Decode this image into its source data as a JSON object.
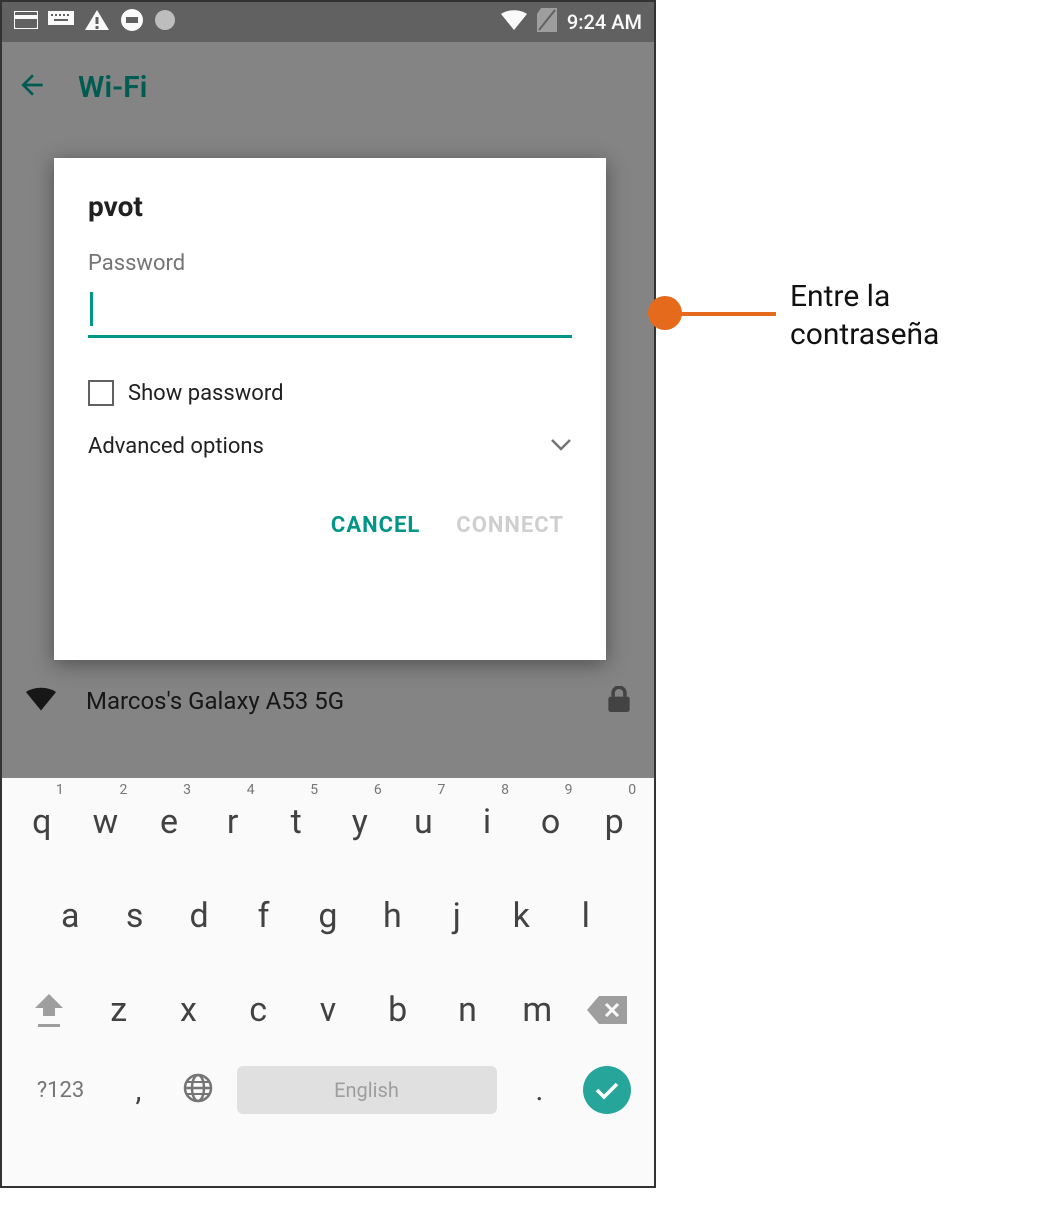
{
  "status": {
    "time": "9:24 AM"
  },
  "header": {
    "title": "Wi-Fi"
  },
  "wifi_list": {
    "visible_item": {
      "name": "Marcos's Galaxy A53 5G"
    }
  },
  "dialog": {
    "network_name": "pvot",
    "password_label": "Password",
    "password_value": "",
    "show_password_label": "Show password",
    "advanced_label": "Advanced options",
    "cancel_label": "CANCEL",
    "connect_label": "CONNECT"
  },
  "keyboard": {
    "row1": [
      {
        "k": "q",
        "s": "1"
      },
      {
        "k": "w",
        "s": "2"
      },
      {
        "k": "e",
        "s": "3"
      },
      {
        "k": "r",
        "s": "4"
      },
      {
        "k": "t",
        "s": "5"
      },
      {
        "k": "y",
        "s": "6"
      },
      {
        "k": "u",
        "s": "7"
      },
      {
        "k": "i",
        "s": "8"
      },
      {
        "k": "o",
        "s": "9"
      },
      {
        "k": "p",
        "s": "0"
      }
    ],
    "row2": [
      "a",
      "s",
      "d",
      "f",
      "g",
      "h",
      "j",
      "k",
      "l"
    ],
    "row3": [
      "z",
      "x",
      "c",
      "v",
      "b",
      "n",
      "m"
    ],
    "symbols_label": "?123",
    "space_label": "English",
    "comma": ",",
    "period": "."
  },
  "annotation": {
    "text": "Entre la\ncontraseña"
  }
}
